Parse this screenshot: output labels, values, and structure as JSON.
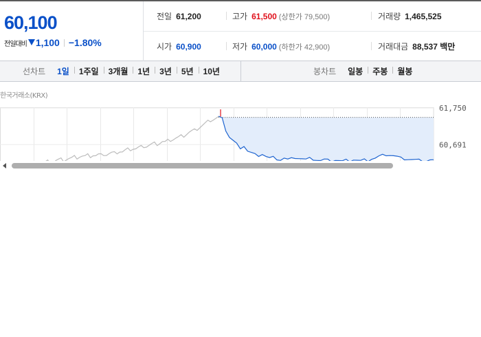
{
  "quote": {
    "current_price": "60,100",
    "change_label": "전일대비",
    "change_amount": "1,100",
    "change_percent": "−1.80%",
    "row1": {
      "prev_label": "전일",
      "prev_value": "61,200",
      "high_label": "고가",
      "high_value": "61,500",
      "upper_limit": "(상한가 79,500)",
      "volume_label": "거래량",
      "volume_value": "1,465,525"
    },
    "row2": {
      "open_label": "시가",
      "open_value": "60,900",
      "low_label": "저가",
      "low_value": "60,000",
      "lower_limit": "(하한가 42,900)",
      "amount_label": "거래대금",
      "amount_value": "88,537 백만"
    },
    "colors": {
      "up": "#e0111c",
      "down": "#0a50c8"
    }
  },
  "tabs": {
    "line_title": "선차트",
    "line_items": [
      "1일",
      "1주일",
      "3개월",
      "1년",
      "3년",
      "5년",
      "10년"
    ],
    "candle_title": "봉차트",
    "candle_items": [
      "일봉",
      "주봉",
      "월봉"
    ]
  },
  "chart": {
    "exchange_label": "한국거래소(KRX)",
    "tick_labels": [
      "61,750",
      "60,691"
    ]
  },
  "chart_data": {
    "type": "line",
    "ylim": [
      60100,
      61750
    ],
    "yticks": [
      61750,
      60691
    ],
    "series": [
      {
        "values": [
          60150,
          60220,
          60180,
          60210,
          60170,
          60200,
          60190,
          60160,
          60230,
          60250,
          60260,
          60240,
          60270,
          60290,
          60300,
          60330,
          60320,
          60350,
          60360,
          60350,
          60380,
          60360,
          60390,
          60370,
          60400,
          60380,
          60420,
          60400,
          60430,
          60450,
          60440,
          60470,
          60500,
          60480,
          60520,
          60550,
          60560,
          60580,
          60570,
          60600,
          60620,
          60650,
          60640,
          60670,
          60700,
          60720,
          60710,
          60740,
          60780,
          60760,
          60800,
          60830,
          60850,
          60880,
          60900,
          60930,
          60950,
          61000,
          61050,
          61080,
          61100,
          61150,
          61200,
          61250,
          61300,
          61350,
          61400,
          61420,
          61450,
          61480
        ]
      },
      {
        "values": [
          61480,
          61500,
          61100,
          60900,
          60800,
          60700,
          60600,
          60650,
          60500,
          60450,
          60400,
          60380,
          60420,
          60350,
          60300,
          60320,
          60280,
          60250,
          60300,
          60260,
          60280,
          60320,
          60300,
          60280,
          60260,
          60290,
          60270,
          60250,
          60230,
          60260,
          60240,
          60220,
          60250,
          60230,
          60210,
          60240,
          60220,
          60260,
          60240,
          60220,
          60250,
          60230,
          60280,
          60300,
          60350,
          60380,
          60400,
          60390,
          60370,
          60340,
          60300,
          60280,
          60270,
          60260,
          60250,
          60240,
          60230,
          60220,
          60250,
          60240
        ]
      }
    ]
  }
}
